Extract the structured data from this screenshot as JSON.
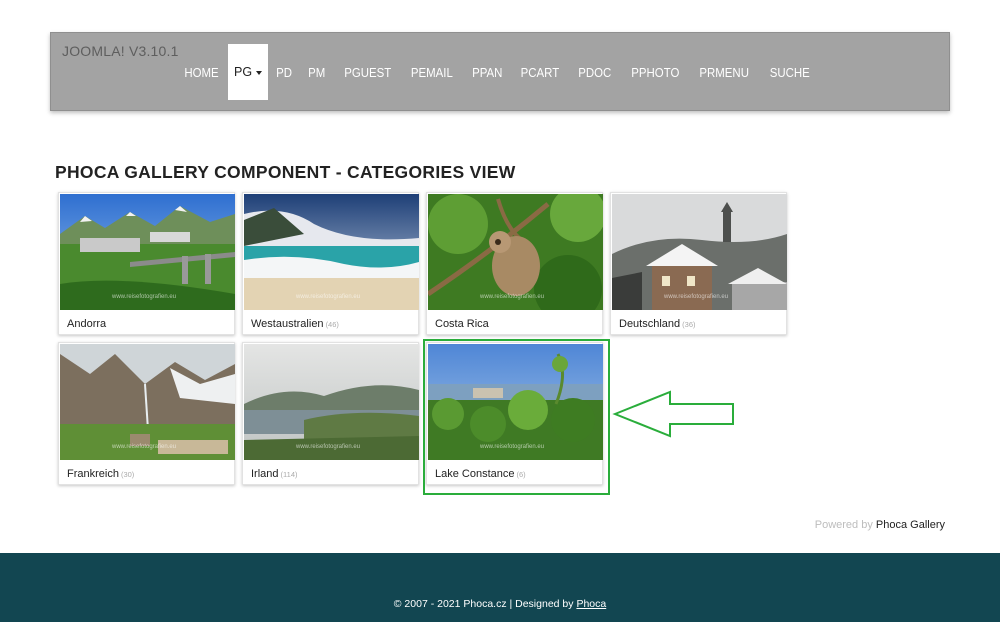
{
  "header": {
    "brand": "JOOMLA! V3.10.1",
    "menu": [
      {
        "label": "HOME",
        "active": false
      },
      {
        "label": "PG",
        "active": true
      },
      {
        "label": "PD",
        "active": false
      },
      {
        "label": "PM",
        "active": false
      },
      {
        "label": "PGUEST",
        "active": false
      },
      {
        "label": "PEMAIL",
        "active": false
      },
      {
        "label": "PPAN",
        "active": false
      },
      {
        "label": "PCART",
        "active": false
      },
      {
        "label": "PDOC",
        "active": false
      },
      {
        "label": "PPHOTO",
        "active": false
      },
      {
        "label": "PRMENU",
        "active": false
      },
      {
        "label": "SUCHE",
        "active": false
      }
    ]
  },
  "page": {
    "title": "PHOCA GALLERY COMPONENT - CATEGORIES VIEW"
  },
  "categories": [
    {
      "name": "Andorra",
      "count": ""
    },
    {
      "name": "Westaustralien",
      "count": "(46)"
    },
    {
      "name": "Costa Rica",
      "count": ""
    },
    {
      "name": "Deutschland",
      "count": "(36)"
    },
    {
      "name": "Frankreich",
      "count": "(30)"
    },
    {
      "name": "Irland",
      "count": "(114)"
    },
    {
      "name": "Lake Constance",
      "count": "(6)"
    }
  ],
  "watermark": "www.reisefotografien.eu",
  "colors": {
    "header_bg": "#a3a3a3",
    "highlight": "#2aad3b",
    "footer_bg": "#124651"
  },
  "powered": {
    "prefix": "Powered by",
    "link": "Phoca Gallery"
  },
  "footer": {
    "text": "© 2007 - 2021 Phoca.cz | Designed by",
    "link": "Phoca"
  }
}
